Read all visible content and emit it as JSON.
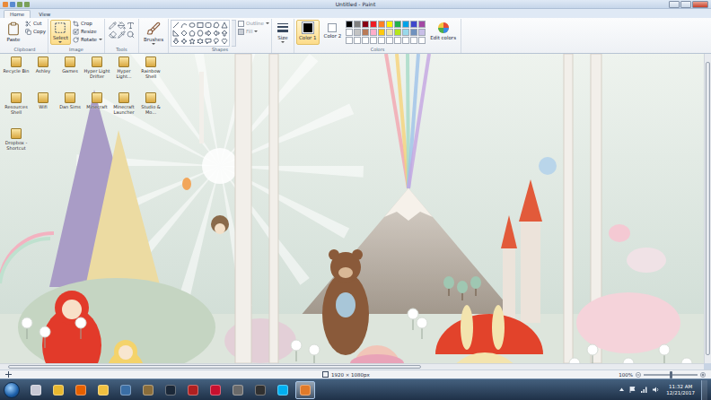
{
  "window": {
    "title": "Untitled - Paint"
  },
  "tabs": [
    {
      "label": "Home",
      "selected": true
    },
    {
      "label": "View",
      "selected": false
    }
  ],
  "ribbon": {
    "clipboard": {
      "label": "Clipboard",
      "paste": "Paste",
      "items": [
        {
          "label": "Cut",
          "disabled": false
        },
        {
          "label": "Copy",
          "disabled": false
        }
      ]
    },
    "image": {
      "label": "Image",
      "select": {
        "label": "Select",
        "selected": true
      },
      "items": [
        {
          "label": "Crop",
          "disabled": false
        },
        {
          "label": "Resize",
          "disabled": false
        },
        {
          "label": "Rotate",
          "disabled": false
        }
      ]
    },
    "tools": {
      "label": "Tools"
    },
    "brushes": {
      "label": "Brushes"
    },
    "shapes": {
      "label": "Shapes",
      "options": [
        {
          "label": "Outline",
          "disabled": true
        },
        {
          "label": "Fill",
          "disabled": true
        }
      ]
    },
    "size": {
      "label": "Size"
    },
    "color_slots": [
      {
        "label": "Color 1",
        "color": "#000000",
        "selected": true
      },
      {
        "label": "Color 2",
        "color": "#ffffff",
        "selected": false
      }
    ],
    "colors": {
      "label": "Colors",
      "palette": [
        {
          "color": "#000000"
        },
        {
          "color": "#7f7f7f"
        },
        {
          "color": "#880015"
        },
        {
          "color": "#ed1c24"
        },
        {
          "color": "#ff7f27"
        },
        {
          "color": "#fff200"
        },
        {
          "color": "#22b14c"
        },
        {
          "color": "#00a2e8"
        },
        {
          "color": "#3f48cc"
        },
        {
          "color": "#a349a4"
        },
        {
          "color": "#ffffff"
        },
        {
          "color": "#c3c3c3"
        },
        {
          "color": "#b97a57"
        },
        {
          "color": "#ffaec9"
        },
        {
          "color": "#ffc90e"
        },
        {
          "color": "#efe4b0"
        },
        {
          "color": "#b5e61d"
        },
        {
          "color": "#99d9ea"
        },
        {
          "color": "#7092be"
        },
        {
          "color": "#c8bfe7"
        },
        {
          "color": "#ffffff"
        },
        {
          "color": "#ffffff"
        },
        {
          "color": "#ffffff"
        },
        {
          "color": "#ffffff"
        },
        {
          "color": "#ffffff"
        },
        {
          "color": "#ffffff"
        },
        {
          "color": "#ffffff"
        },
        {
          "color": "#ffffff"
        },
        {
          "color": "#ffffff"
        },
        {
          "color": "#ffffff"
        }
      ]
    },
    "edit_colors": {
      "label": "Edit colors"
    }
  },
  "desktop_icons": [
    {
      "label": "Recycle Bin"
    },
    {
      "label": "Ashley"
    },
    {
      "label": "Games"
    },
    {
      "label": "Hyper Light Drifter"
    },
    {
      "label": "Hyper Light..."
    },
    {
      "label": "Rainbow Shell"
    },
    {
      "label": "Resources Shell"
    },
    {
      "label": "Wifi"
    },
    {
      "label": "Dan Sims"
    },
    {
      "label": "Minecraft"
    },
    {
      "label": "Minecraft Launcher"
    },
    {
      "label": "Studio & Mo..."
    },
    {
      "label": "Dropbox - Shortcut"
    }
  ],
  "status_bar": {
    "dimensions": "1920 × 1080px",
    "zoom": "100%",
    "zoom_level": 0.5
  },
  "taskbar": {
    "apps": [
      {
        "color": "#c7c9d6",
        "selected": false
      },
      {
        "color": "#e8b830",
        "selected": false
      },
      {
        "color": "#e66000",
        "selected": false
      },
      {
        "color": "#f0c040",
        "selected": false
      },
      {
        "color": "#3a6ea5",
        "selected": false
      },
      {
        "color": "#8a6d3b",
        "selected": false
      },
      {
        "color": "#1b2838",
        "selected": false
      },
      {
        "color": "#b02020",
        "selected": false
      },
      {
        "color": "#c8102e",
        "selected": false
      },
      {
        "color": "#6a6a6a",
        "selected": false
      },
      {
        "color": "#303030",
        "selected": false
      },
      {
        "color": "#00aff0",
        "selected": false
      },
      {
        "color": "#e07a2a",
        "selected": true
      }
    ],
    "time": "11:32 AM",
    "date": "12/21/2017"
  }
}
